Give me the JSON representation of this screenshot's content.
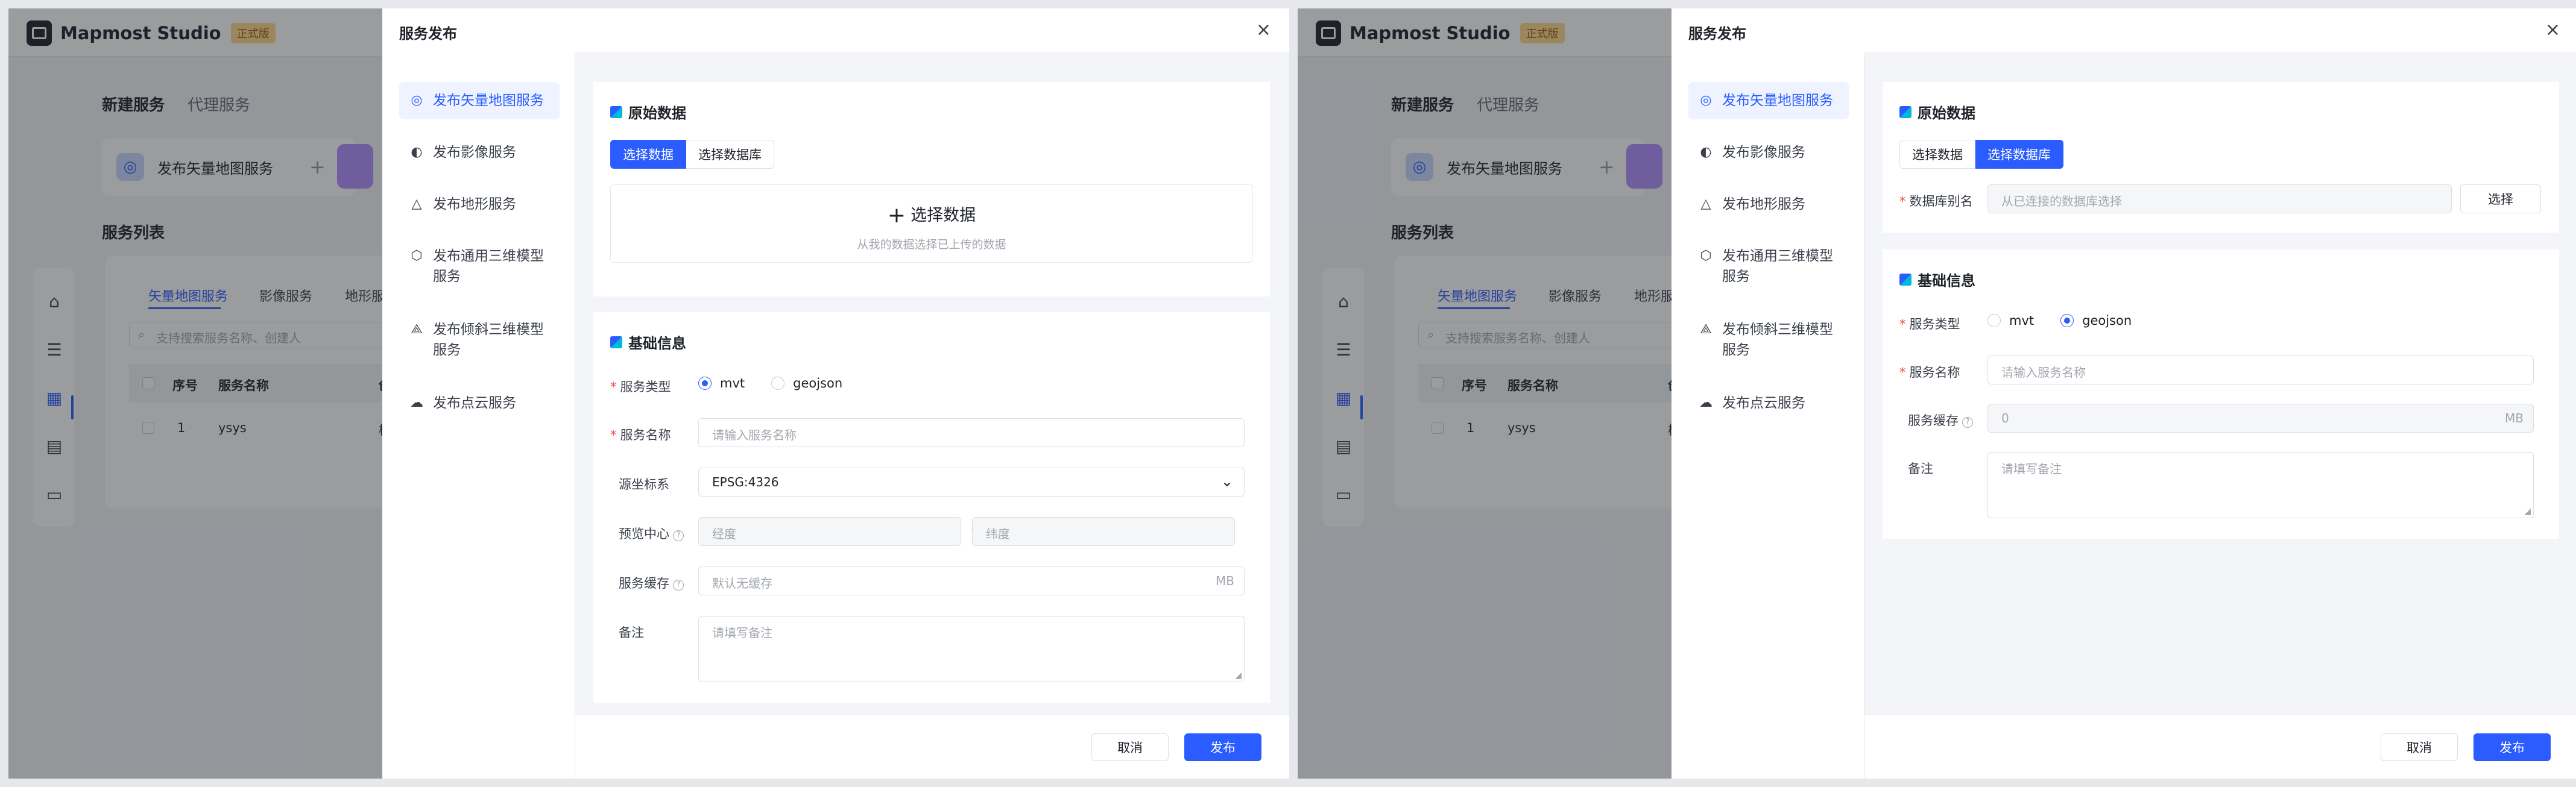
{
  "app": {
    "brand": "Mapmost Studio",
    "edition": "正式版",
    "tab_new": "新建服务",
    "tab_proxy": "代理服务",
    "card_label": "发布矢量地图服务",
    "card_plus": "+",
    "list_title": "服务列表",
    "table_tabs": [
      "矢量地图服务",
      "影像服务",
      "地形服"
    ],
    "search_placeholder": "支持搜索服务名称、创建人",
    "columns": [
      "序号",
      "服务名称",
      "创"
    ],
    "row": {
      "index": "1",
      "name": "ysys",
      "creator": "杨"
    }
  },
  "modal": {
    "title": "服务发布",
    "close": "×",
    "menu": [
      {
        "icon": "globe-icon",
        "label": "发布矢量地图服务"
      },
      {
        "icon": "image-globe-icon",
        "label": "发布影像服务"
      },
      {
        "icon": "mountain-icon",
        "label": "发布地形服务"
      },
      {
        "icon": "cube-icon",
        "label": "发布通用三维模型服务"
      },
      {
        "icon": "pyramid-icon",
        "label": "发布倾斜三维模型服务"
      },
      {
        "icon": "cloud-icon",
        "label": "发布点云服务"
      }
    ],
    "source_section": "原始数据",
    "seg_data": "选择数据",
    "seg_db": "选择数据库",
    "upload_label": "选择数据",
    "upload_hint": "从我的数据选择已上传的数据",
    "basic_section": "基础信息",
    "service_type_label": "服务类型",
    "type_mvt": "mvt",
    "type_geojson": "geojson",
    "service_name_label": "服务名称",
    "service_name_placeholder": "请输入服务名称",
    "crs_label": "源坐标系",
    "crs_value": "EPSG:4326",
    "center_label": "预览中心",
    "lng_placeholder": "经度",
    "lat_placeholder": "纬度",
    "cache_label": "服务缓存",
    "cache_placeholder": "默认无缓存",
    "cache_value_right": "0",
    "cache_unit": "MB",
    "note_label": "备注",
    "note_placeholder": "请填写备注",
    "db_alias_label": "数据库别名",
    "db_alias_placeholder": "从已连接的数据库选择",
    "pick_button": "选择",
    "cancel_button": "取消",
    "publish_button": "发布"
  },
  "colors": {
    "primary": "#2a5cff",
    "required": "#f54a45",
    "edition_bg": "#ffd98a"
  }
}
